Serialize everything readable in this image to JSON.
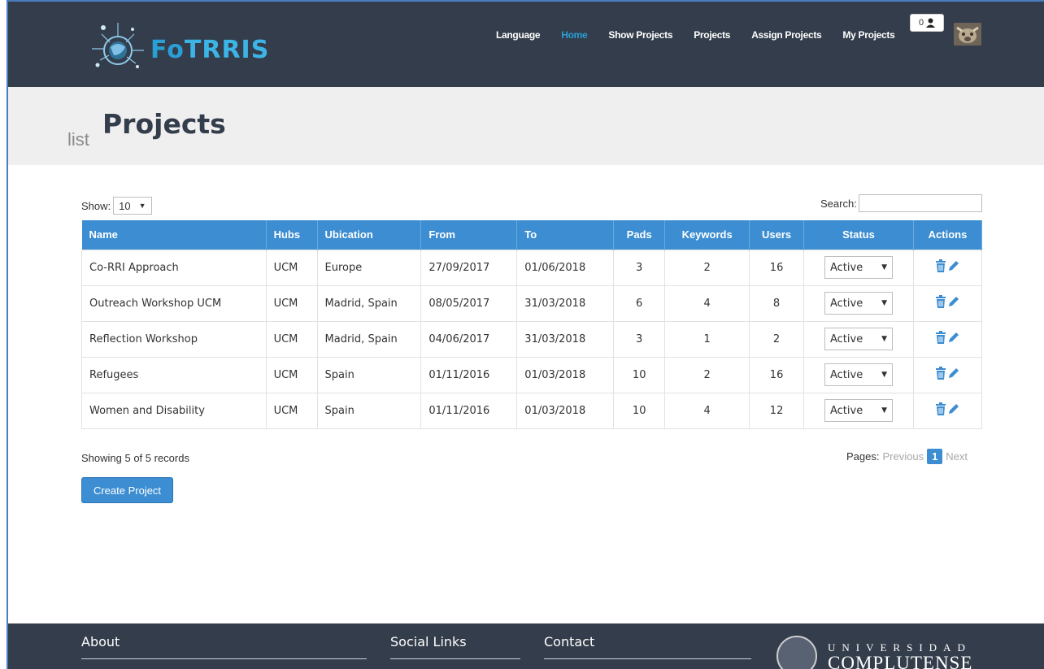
{
  "app": {
    "logo_text_1": "Fo",
    "logo_text_2": "TRRIS",
    "brand_color": "#2a9fd6"
  },
  "nav": {
    "items": [
      {
        "label": "Language",
        "active": false
      },
      {
        "label": "Home",
        "active": true
      },
      {
        "label": "Show Projects",
        "active": false
      },
      {
        "label": "Projects",
        "active": false
      },
      {
        "label": "Assign Projects",
        "active": false
      },
      {
        "label": "My Projects",
        "active": false
      }
    ],
    "user_count": "0",
    "user_icon": "user-icon"
  },
  "page": {
    "title_prefix": "list",
    "title": "Projects"
  },
  "controls": {
    "show_label": "Show:",
    "show_value": "10",
    "search_label": "Search:",
    "search_value": ""
  },
  "table": {
    "headers": [
      "Name",
      "Hubs",
      "Ubication",
      "From",
      "To",
      "Pads",
      "Keywords",
      "Users",
      "Status",
      "Actions"
    ],
    "rows": [
      {
        "name": "Co-RRI Approach",
        "hubs": "UCM",
        "ubication": "Europe",
        "from": "27/09/2017",
        "to": "01/06/2018",
        "pads": "3",
        "keywords": "2",
        "users": "16",
        "status": "Active"
      },
      {
        "name": "Outreach Workshop UCM",
        "hubs": "UCM",
        "ubication": "Madrid, Spain",
        "from": "08/05/2017",
        "to": "31/03/2018",
        "pads": "6",
        "keywords": "4",
        "users": "8",
        "status": "Active"
      },
      {
        "name": "Reflection Workshop",
        "hubs": "UCM",
        "ubication": "Madrid, Spain",
        "from": "04/06/2017",
        "to": "31/03/2018",
        "pads": "3",
        "keywords": "1",
        "users": "2",
        "status": "Active"
      },
      {
        "name": "Refugees",
        "hubs": "UCM",
        "ubication": "Spain",
        "from": "01/11/2016",
        "to": "01/03/2018",
        "pads": "10",
        "keywords": "2",
        "users": "16",
        "status": "Active"
      },
      {
        "name": "Women and Disability",
        "hubs": "UCM",
        "ubication": "Spain",
        "from": "01/11/2016",
        "to": "01/03/2018",
        "pads": "10",
        "keywords": "4",
        "users": "12",
        "status": "Active"
      }
    ]
  },
  "pagination": {
    "showing": "Showing 5 of 5 records",
    "pages_label": "Pages:",
    "previous": "Previous",
    "current": "1",
    "next": "Next"
  },
  "create_button": "Create Project",
  "footer": {
    "about": "About",
    "social": "Social Links",
    "contact": "Contact",
    "ucm_line1": "UNIVERSIDAD",
    "ucm_line2": "COMPLUTENSE"
  }
}
